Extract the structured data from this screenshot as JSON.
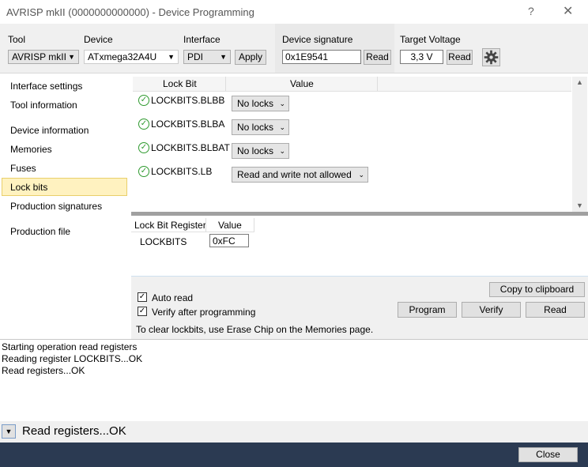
{
  "window": {
    "title": "AVRISP mkII (0000000000000) - Device Programming",
    "help_glyph": "?",
    "close_glyph": "✕"
  },
  "toolbar": {
    "tool_label": "Tool",
    "tool_value": "AVRISP mkII",
    "device_label": "Device",
    "device_value": "ATxmega32A4U",
    "interface_label": "Interface",
    "interface_value": "PDI",
    "apply_label": "Apply",
    "signature_label": "Device signature",
    "signature_value": "0x1E9541",
    "signature_read": "Read",
    "voltage_label": "Target Voltage",
    "voltage_value": "3,3 V",
    "voltage_read": "Read",
    "settings_icon": "gear-icon"
  },
  "nav": {
    "items": [
      "Interface settings",
      "Tool information",
      "Device information",
      "Memories",
      "Fuses",
      "Lock bits",
      "Production signatures",
      "Production file"
    ],
    "selected": "Lock bits"
  },
  "lockbits": {
    "col_lockbit": "Lock Bit",
    "col_value": "Value",
    "rows": [
      {
        "name": "LOCKBITS.BLBB",
        "value": "No locks"
      },
      {
        "name": "LOCKBITS.BLBA",
        "value": "No locks"
      },
      {
        "name": "LOCKBITS.BLBAT",
        "value": "No locks"
      },
      {
        "name": "LOCKBITS.LB",
        "value": "Read and write not allowed"
      }
    ]
  },
  "register": {
    "col_register": "Lock Bit Register",
    "col_value": "Value",
    "name": "LOCKBITS",
    "value": "0xFC"
  },
  "actions": {
    "auto_read": "Auto read",
    "auto_read_checked": true,
    "verify_after": "Verify after programming",
    "verify_after_checked": true,
    "hint": "To clear lockbits, use Erase Chip on the Memories page.",
    "copy": "Copy to clipboard",
    "program": "Program",
    "verify": "Verify",
    "read": "Read"
  },
  "log": {
    "lines": [
      "Starting operation read registers",
      "Reading register LOCKBITS...OK",
      "Read registers...OK"
    ]
  },
  "status": {
    "text": "Read registers...OK"
  },
  "footer": {
    "close": "Close"
  }
}
